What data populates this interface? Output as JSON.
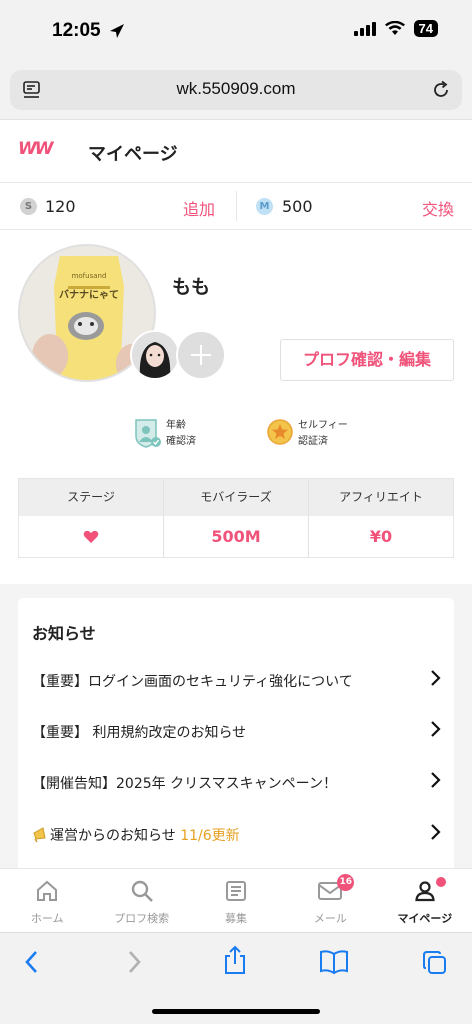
{
  "status_bar": {
    "time": "12:05",
    "battery": "74"
  },
  "browser": {
    "url": "wk.550909.com"
  },
  "header": {
    "logo": "WW",
    "title": "マイページ"
  },
  "points": {
    "s_icon": "S",
    "s_value": "120",
    "add_label": "追加",
    "m_icon": "M",
    "m_value": "500",
    "exchange_label": "交換"
  },
  "profile": {
    "nickname": "もも",
    "edit_button": "プロフ確認・編集",
    "avatar_photo_text": "バナナにゃて",
    "avatar_photo_brand": "mofusand"
  },
  "badges": {
    "age_line1": "年齢",
    "age_line2": "確認済",
    "selfie_line1": "セルフィー",
    "selfie_line2": "認証済"
  },
  "stats": {
    "headers": [
      "ステージ",
      "モバイラーズ",
      "アフィリエイト"
    ],
    "stage_icon": "heart-icon",
    "mobilers": "500M",
    "affiliate": "¥0"
  },
  "news": {
    "title": "お知らせ",
    "items": [
      {
        "text": "【重要】ログイン画面のセキュリティ強化について"
      },
      {
        "text": "【重要】 利用規約改定のお知らせ"
      },
      {
        "text": "【開催告知】2025年 クリスマスキャンペーン！"
      },
      {
        "text": "運営からのお知らせ",
        "highlight": "11/6更新"
      }
    ]
  },
  "tabs": [
    {
      "label": "ホーム",
      "icon": "home-icon"
    },
    {
      "label": "プロフ検索",
      "icon": "search-icon"
    },
    {
      "label": "募集",
      "icon": "list-icon"
    },
    {
      "label": "メール",
      "icon": "mail-icon",
      "badge": "16"
    },
    {
      "label": "マイページ",
      "icon": "person-icon"
    }
  ],
  "colors": {
    "accent": "#f0527a",
    "highlight": "#e6a020"
  }
}
